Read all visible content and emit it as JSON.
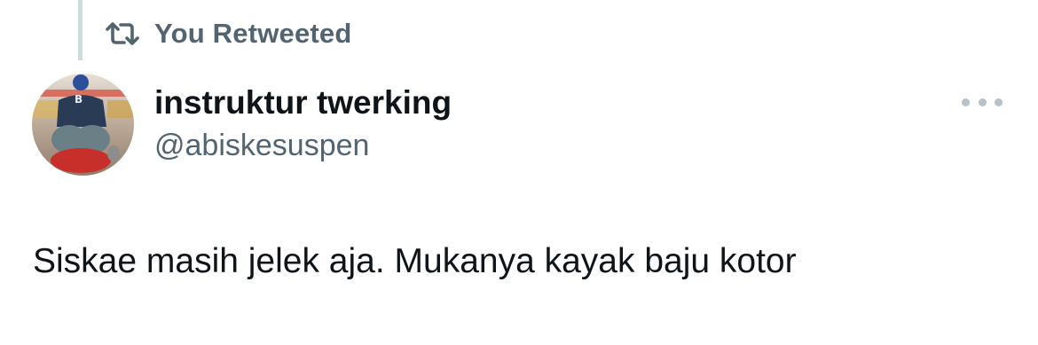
{
  "social_context": {
    "icon": "retweet-icon",
    "text": "You Retweeted"
  },
  "author": {
    "display_name": "instruktur twerking",
    "handle": "@abiskesuspen",
    "avatar": "avatar-photo"
  },
  "more_button": {
    "icon": "more-horizontal-icon"
  },
  "tweet": {
    "text": "Siskae masih jelek aja. Mukanya kayak baju kotor"
  },
  "colors": {
    "primary_text": "#0f1419",
    "secondary_text": "#536471",
    "thread_line": "#cfd9de",
    "more_dots": "#b8c1c8",
    "background": "#ffffff"
  }
}
